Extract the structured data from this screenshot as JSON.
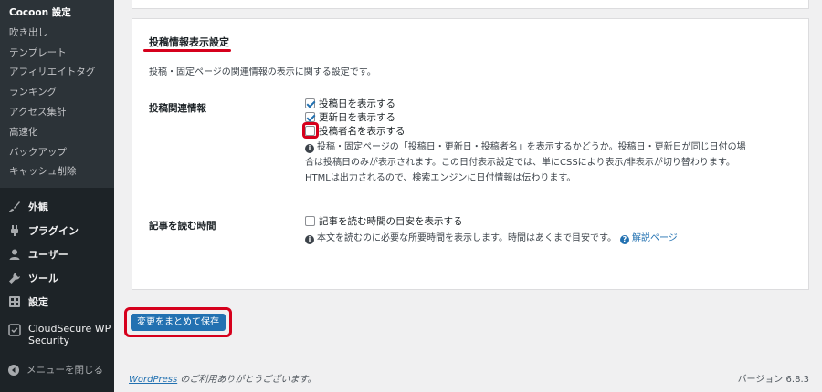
{
  "sidebar": {
    "submenu": [
      "Cocoon 設定",
      "吹き出し",
      "テンプレート",
      "アフィリエイトタグ",
      "ランキング",
      "アクセス集計",
      "高速化",
      "バックアップ",
      "キャッシュ削除"
    ],
    "menu": [
      {
        "label": "外観",
        "icon": "paintbrush-icon"
      },
      {
        "label": "プラグイン",
        "icon": "plugin-icon"
      },
      {
        "label": "ユーザー",
        "icon": "users-icon"
      },
      {
        "label": "ツール",
        "icon": "wrench-icon"
      },
      {
        "label": "設定",
        "icon": "settings-icon"
      }
    ],
    "security": {
      "line1": "CloudSecure WP",
      "line2": "Security"
    },
    "collapse": "メニューを閉じる"
  },
  "panel": {
    "title": "投稿情報表示設定",
    "description": "投稿・固定ページの関連情報の表示に関する設定です。",
    "post_info": {
      "label": "投稿関連情報",
      "options": [
        {
          "label": "投稿日を表示する",
          "checked": true
        },
        {
          "label": "更新日を表示する",
          "checked": true
        },
        {
          "label": "投稿者名を表示する",
          "checked": false
        }
      ],
      "help": [
        "投稿・固定ページの「投稿日・更新日・投稿者名」を表示するかどうか。投稿日・更新日が同じ日付の場",
        "合は投稿日のみが表示されます。この日付表示設定では、単にCSSにより表示/非表示が切り替わります。",
        "HTMLは出力されるので、検索エンジンに日付情報は伝わります。"
      ]
    },
    "reading_time": {
      "label": "記事を読む時間",
      "option": {
        "label": "記事を読む時間の目安を表示する",
        "checked": false
      },
      "help": "本文を読むのに必要な所要時間を表示します。時間はあくまで目安です。",
      "link": "解説ページ"
    }
  },
  "save_button": "変更をまとめて保存",
  "footer": {
    "wordpress": "WordPress",
    "thanks": " のご利用ありがとうございます。",
    "version": "バージョン 6.8.3"
  }
}
